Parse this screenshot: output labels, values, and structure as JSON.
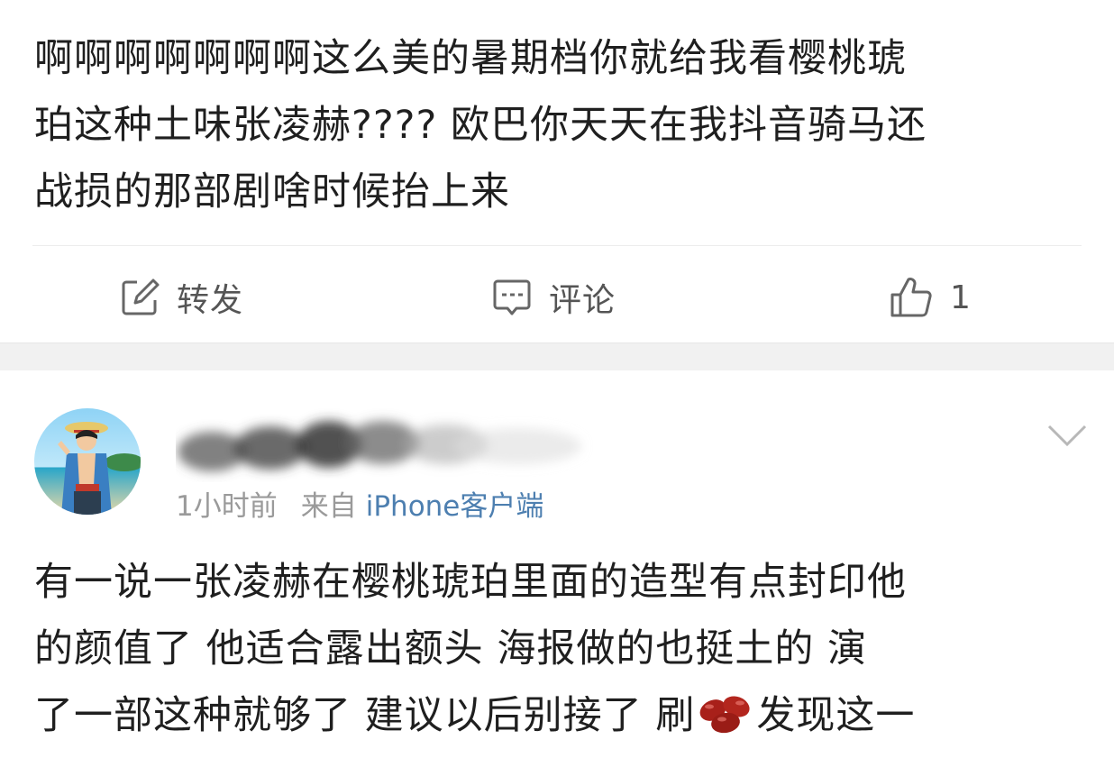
{
  "post1": {
    "text": "啊啊啊啊啊啊啊这么美的暑期档你就给我看樱桃琥\n珀这种土味张凌赫???? 欧巴你天天在我抖音骑马还\n战损的那部剧啥时候抬上来",
    "actions": {
      "repost_label": "转发",
      "comment_label": "评论",
      "like_count": "1"
    }
  },
  "post2": {
    "time": "1小时前",
    "source_prefix": "来自",
    "source_client": "iPhone客户端",
    "text_before_emoji": "有一说一张凌赫在樱桃琥珀里面的造型有点封印他\n的颜值了  他适合露出额头 海报做的也挺土的   演\n了一部这种就够了  建议以后别接了  刷",
    "emoji": "red-beans-icon",
    "text_after_emoji": "发现这一"
  },
  "colors": {
    "text": "#1f1f1f",
    "meta": "#9a9a9a",
    "link": "#4d7fb0",
    "divider": "#ececec",
    "gap": "#f1f1f1"
  }
}
